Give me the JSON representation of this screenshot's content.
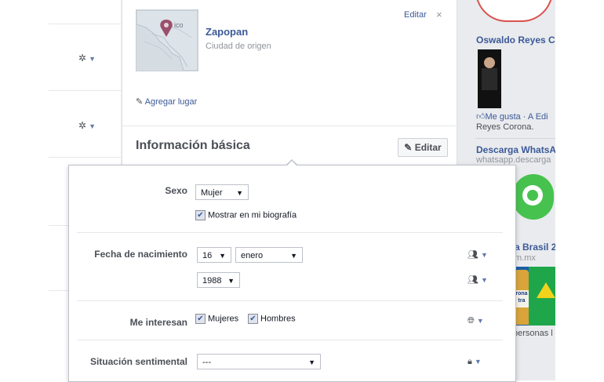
{
  "location": {
    "edit_link": "Editar",
    "close_icon": "×",
    "map_label": "ico",
    "city": "Zapopan",
    "city_type": "Ciudad de origen",
    "add_place": "Agregar lugar"
  },
  "section": {
    "title": "Información básica",
    "edit_button": "Editar"
  },
  "form": {
    "sex_label": "Sexo",
    "sex_value": "Mujer",
    "show_bio_label": "Mostrar en mi biografía",
    "dob_label": "Fecha de nacimiento",
    "day_value": "16",
    "month_value": "enero",
    "year_value": "1988",
    "interest_label": "Me interesan",
    "interest_options": [
      "Mujeres",
      "Hombres"
    ],
    "relationship_label": "Situación sentimental",
    "relationship_value": "---"
  },
  "right_column": {
    "post1_title": "Oswaldo Reyes C",
    "post1_likes": "Me gusta · A Edi",
    "post1_name": "Reyes Corona.",
    "post2_title": "Descarga WhatsA",
    "post2_url": "whatsapp.descarga",
    "post3_title": "a Brasil 2",
    "post3_url": "m.mx",
    "post3_people": "personas l",
    "beer_label_1": "rona",
    "beer_label_2": "tra"
  },
  "colors": {
    "link": "#3b5998",
    "background": "#e9ebee",
    "map_pin": "#9b4f6b"
  },
  "icons": {
    "gear": "gear-icon",
    "pencil": "pencil-icon",
    "friends": "friends-icon",
    "globe": "globe-icon",
    "lock": "lock-icon",
    "thumb": "like-icon"
  }
}
